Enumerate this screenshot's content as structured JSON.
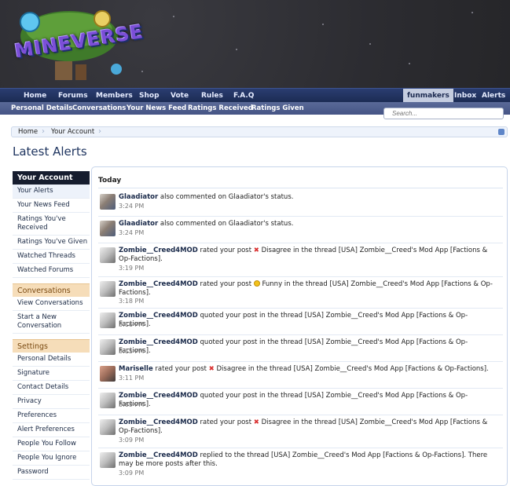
{
  "logo": {
    "text": "MINEVERSE"
  },
  "nav": {
    "items": [
      "Home",
      "Forums",
      "Members",
      "Shop",
      "Vote",
      "Rules",
      "F.A.Q"
    ],
    "user": "funmakers",
    "inbox": "Inbox",
    "alerts": "Alerts"
  },
  "subnav": {
    "items": [
      "Personal Details",
      "Conversations",
      "Your News Feed",
      "Ratings Received",
      "Ratings Given"
    ]
  },
  "search": {
    "placeholder": "Search..."
  },
  "breadcrumb": {
    "home": "Home",
    "account": "Your Account"
  },
  "page_title": "Latest Alerts",
  "sidebar": {
    "account_head": "Your Account",
    "account_items": [
      "Your Alerts",
      "Your News Feed",
      "Ratings You've Received",
      "Ratings You've Given",
      "Watched Threads",
      "Watched Forums"
    ],
    "conversations_head": "Conversations",
    "conversation_items": [
      "View Conversations",
      "Start a New Conversation"
    ],
    "settings_head": "Settings",
    "settings_items": [
      "Personal Details",
      "Signature",
      "Contact Details",
      "Privacy",
      "Preferences",
      "Alert Preferences",
      "People You Follow",
      "People You Ignore",
      "Password"
    ]
  },
  "alerts": {
    "section": "Today",
    "items": [
      {
        "user": "Glaadiator",
        "pre": " also commented on Glaadiator's status.",
        "rating": "",
        "post": "",
        "time": "3:24 PM"
      },
      {
        "user": "Glaadiator",
        "pre": " also commented on Glaadiator's status.",
        "rating": "",
        "post": "",
        "time": "3:24 PM"
      },
      {
        "user": "Zombie__Creed4MOD",
        "pre": " rated your post ",
        "rating": "Disagree",
        "post": " in the thread [USA] Zombie__Creed's Mod App [Factions & Op-Factions].",
        "time": "3:19 PM"
      },
      {
        "user": "Zombie__Creed4MOD",
        "pre": " rated your post ",
        "rating": "Funny",
        "post": " in the thread [USA] Zombie__Creed's Mod App [Factions & Op-Factions].",
        "time": "3:18 PM"
      },
      {
        "user": "Zombie__Creed4MOD",
        "pre": " quoted your post in the thread [USA] Zombie__Creed's Mod App [Factions & Op-Factions].",
        "rating": "",
        "post": "",
        "time": "3:16 PM"
      },
      {
        "user": "Zombie__Creed4MOD",
        "pre": " quoted your post in the thread [USA] Zombie__Creed's Mod App [Factions & Op-Factions].",
        "rating": "",
        "post": "",
        "time": "3:15 PM"
      },
      {
        "user": "Mariselle",
        "pre": " rated your post ",
        "rating": "Disagree",
        "post": " in the thread [USA] Zombie__Creed's Mod App [Factions & Op-Factions].",
        "time": "3:11 PM"
      },
      {
        "user": "Zombie__Creed4MOD",
        "pre": " quoted your post in the thread [USA] Zombie__Creed's Mod App [Factions & Op-Factions].",
        "rating": "",
        "post": "",
        "time": "3:09 PM"
      },
      {
        "user": "Zombie__Creed4MOD",
        "pre": " rated your post ",
        "rating": "Disagree",
        "post": " in the thread [USA] Zombie__Creed's Mod App [Factions & Op-Factions].",
        "time": "3:09 PM"
      },
      {
        "user": "Zombie__Creed4MOD",
        "pre": " replied to the thread [USA] Zombie__Creed's Mod App [Factions & Op-Factions]. There may be more posts after this.",
        "rating": "",
        "post": "",
        "time": "3:09 PM"
      }
    ]
  }
}
